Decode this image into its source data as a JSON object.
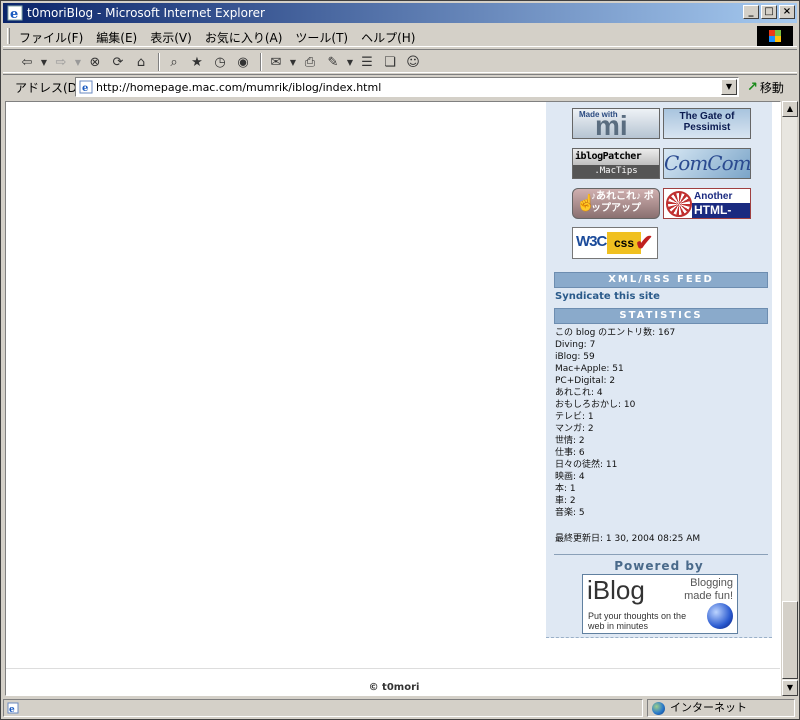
{
  "window": {
    "title": "t0moriBlog - Microsoft Internet Explorer",
    "controls": [
      "_",
      "□",
      "×"
    ]
  },
  "menu": [
    "ファイル(F)",
    "編集(E)",
    "表示(V)",
    "お気に入り(A)",
    "ツール(T)",
    "ヘルプ(H)"
  ],
  "toolbar": {
    "icons": [
      "back-icon",
      "forward-icon",
      "stop-icon",
      "refresh-icon",
      "home-icon",
      "search-icon",
      "favorites-icon",
      "history-icon",
      "media-icon",
      "mail-icon",
      "print-icon",
      "edit-icon",
      "discuss-icon",
      "messenger-icon"
    ]
  },
  "address": {
    "label": "アドレス(D)",
    "url": "http://homepage.mac.com/mumrik/iblog/index.html",
    "go_label": "移動"
  },
  "badges": {
    "mi_top": "Made with",
    "mi_main": "mi",
    "gate": "The Gate of Pessimist",
    "iblogpatcher_main": "iblogPatcher",
    "iblogpatcher_sub": ".MacTips",
    "comcom": "ComCom",
    "arekore": "♪あれこれ♪ ポップアップ",
    "htmllint_top": "Another",
    "htmllint_main": "HTML-lint",
    "w3c_main": "W3C",
    "w3c_css": "css"
  },
  "sidebar": {
    "feed_title": "XML/RSS FEED",
    "syndicate": "Syndicate this site",
    "stats_title": "STATISTICS",
    "stats": [
      "この blog のエントリ数: 167",
      "Diving: 7",
      "iBlog: 59",
      "Mac+Apple: 51",
      "PC+Digital: 2",
      "あれこれ: 4",
      "おもしろおかし: 10",
      "テレビ: 1",
      "マンガ: 2",
      "世情: 2",
      "仕事: 6",
      "日々の徒然: 11",
      "映画: 4",
      "本: 1",
      "車: 2",
      "音楽: 5"
    ],
    "last_updated": "最終更新日: 1 30, 2004 08:25 AM",
    "powered_by": "Powered by",
    "iblog_logo": "iBlog",
    "iblog_tag": "Blogging made fun!",
    "iblog_sub": "Put your thoughts on the web in minutes"
  },
  "footer": {
    "copyright": "© t0mori"
  },
  "status": {
    "zone": "インターネット"
  }
}
